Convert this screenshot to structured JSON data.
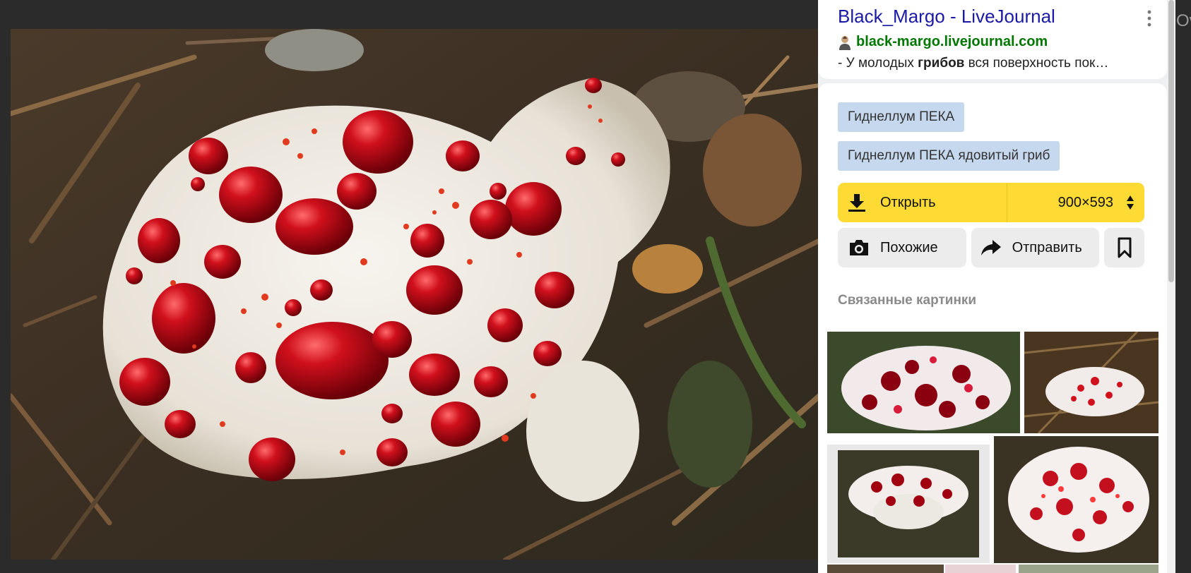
{
  "source": {
    "title": "Black_Margo - LiveJournal",
    "domain": "black-margo.livejournal.com",
    "snippet_before": "- У молодых ",
    "snippet_bold": "грибов",
    "snippet_after": " вся поверхность пок…"
  },
  "tags": [
    "Гиднеллум ПЕКА",
    "Гиднеллум ПЕКА ядовитый гриб"
  ],
  "open": {
    "label": "Открыть",
    "size": "900×593"
  },
  "actions": {
    "similar": "Похожие",
    "send": "Отправить"
  },
  "related_title": "Связанные картинки",
  "edge_text": "Ov",
  "colors": {
    "accent_yellow": "#fddb34",
    "tag_bg": "#c6d8ee",
    "link_blue": "#1a1aa6",
    "domain_green": "#007700"
  },
  "icons": [
    "user-icon",
    "more-vertical-icon",
    "download-icon",
    "updown-arrows-icon",
    "camera-icon",
    "share-arrow-icon",
    "bookmark-icon"
  ]
}
